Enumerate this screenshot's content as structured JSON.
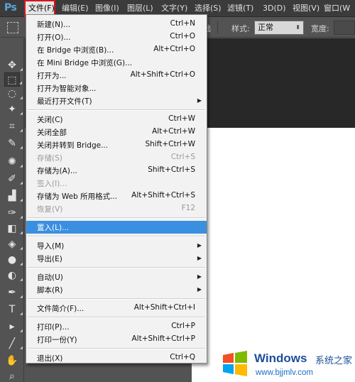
{
  "app": {
    "logo_text": "Ps"
  },
  "menubar": {
    "items": [
      {
        "label": "文件(F)",
        "active": true
      },
      {
        "label": "编辑(E)"
      },
      {
        "label": "图像(I)"
      },
      {
        "label": "图层(L)"
      },
      {
        "label": "文字(Y)"
      },
      {
        "label": "选择(S)"
      },
      {
        "label": "滤镜(T)"
      },
      {
        "label": "3D(D)"
      },
      {
        "label": "视图(V)"
      },
      {
        "label": "窗口(W"
      }
    ]
  },
  "options_bar": {
    "partial_label": "础",
    "style_label": "样式:",
    "style_value": "正常",
    "width_label": "宽度:"
  },
  "toolbar": {
    "tools": [
      {
        "name": "move-tool-icon",
        "glyph": "✥"
      },
      {
        "name": "marquee-tool-icon",
        "glyph": "⬚",
        "selected": true
      },
      {
        "name": "lasso-tool-icon",
        "glyph": "◌"
      },
      {
        "name": "quick-selection-tool-icon",
        "glyph": "✦"
      },
      {
        "name": "crop-tool-icon",
        "glyph": "⌗"
      },
      {
        "name": "eyedropper-tool-icon",
        "glyph": "✎"
      },
      {
        "name": "spot-healing-tool-icon",
        "glyph": "✺"
      },
      {
        "name": "brush-tool-icon",
        "glyph": "✐"
      },
      {
        "name": "clone-stamp-tool-icon",
        "glyph": "▟"
      },
      {
        "name": "history-brush-tool-icon",
        "glyph": "✑"
      },
      {
        "name": "eraser-tool-icon",
        "glyph": "◧"
      },
      {
        "name": "paint-bucket-tool-icon",
        "glyph": "◈"
      },
      {
        "name": "blur-tool-icon",
        "glyph": "●"
      },
      {
        "name": "dodge-tool-icon",
        "glyph": "◐"
      },
      {
        "name": "pen-tool-icon",
        "glyph": "✒"
      },
      {
        "name": "type-tool-icon",
        "glyph": "T"
      },
      {
        "name": "path-selection-tool-icon",
        "glyph": "▸"
      },
      {
        "name": "line-tool-icon",
        "glyph": "╱"
      },
      {
        "name": "hand-tool-icon",
        "glyph": "✋"
      },
      {
        "name": "zoom-tool-icon",
        "glyph": "⌕"
      }
    ]
  },
  "file_menu": {
    "items": [
      {
        "label": "新建(N)...",
        "shortcut": "Ctrl+N"
      },
      {
        "label": "打开(O)...",
        "shortcut": "Ctrl+O"
      },
      {
        "label": "在 Bridge 中浏览(B)...",
        "shortcut": "Alt+Ctrl+O"
      },
      {
        "label": "在 Mini Bridge 中浏览(G)...",
        "shortcut": ""
      },
      {
        "label": "打开为...",
        "shortcut": "Alt+Shift+Ctrl+O"
      },
      {
        "label": "打开为智能对象...",
        "shortcut": ""
      },
      {
        "label": "最近打开文件(T)",
        "shortcut": "",
        "submenu": true
      },
      {
        "separator": true
      },
      {
        "label": "关闭(C)",
        "shortcut": "Ctrl+W"
      },
      {
        "label": "关闭全部",
        "shortcut": "Alt+Ctrl+W"
      },
      {
        "label": "关闭并转到 Bridge...",
        "shortcut": "Shift+Ctrl+W"
      },
      {
        "label": "存储(S)",
        "shortcut": "Ctrl+S",
        "disabled": true
      },
      {
        "label": "存储为(A)...",
        "shortcut": "Shift+Ctrl+S"
      },
      {
        "label": "签入(I)...",
        "shortcut": "",
        "disabled": true
      },
      {
        "label": "存储为 Web 所用格式...",
        "shortcut": "Alt+Shift+Ctrl+S"
      },
      {
        "label": "恢复(V)",
        "shortcut": "F12",
        "disabled": true
      },
      {
        "separator": true
      },
      {
        "label": "置入(L)...",
        "shortcut": "",
        "highlight": true
      },
      {
        "separator": true
      },
      {
        "label": "导入(M)",
        "shortcut": "",
        "submenu": true
      },
      {
        "label": "导出(E)",
        "shortcut": "",
        "submenu": true
      },
      {
        "separator": true
      },
      {
        "label": "自动(U)",
        "shortcut": "",
        "submenu": true
      },
      {
        "label": "脚本(R)",
        "shortcut": "",
        "submenu": true
      },
      {
        "separator": true
      },
      {
        "label": "文件简介(F)...",
        "shortcut": "Alt+Shift+Ctrl+I"
      },
      {
        "separator": true
      },
      {
        "label": "打印(P)...",
        "shortcut": "Ctrl+P"
      },
      {
        "label": "打印一份(Y)",
        "shortcut": "Alt+Shift+Ctrl+P"
      },
      {
        "separator": true
      },
      {
        "label": "退出(X)",
        "shortcut": "Ctrl+Q"
      }
    ]
  },
  "watermark": {
    "title": "Windows",
    "subtitle": "系统之家",
    "url": "www.bjjmlv.com",
    "colors": {
      "red": "#f25022",
      "green": "#7fba00",
      "blue": "#00a4ef",
      "yellow": "#ffb900"
    }
  }
}
